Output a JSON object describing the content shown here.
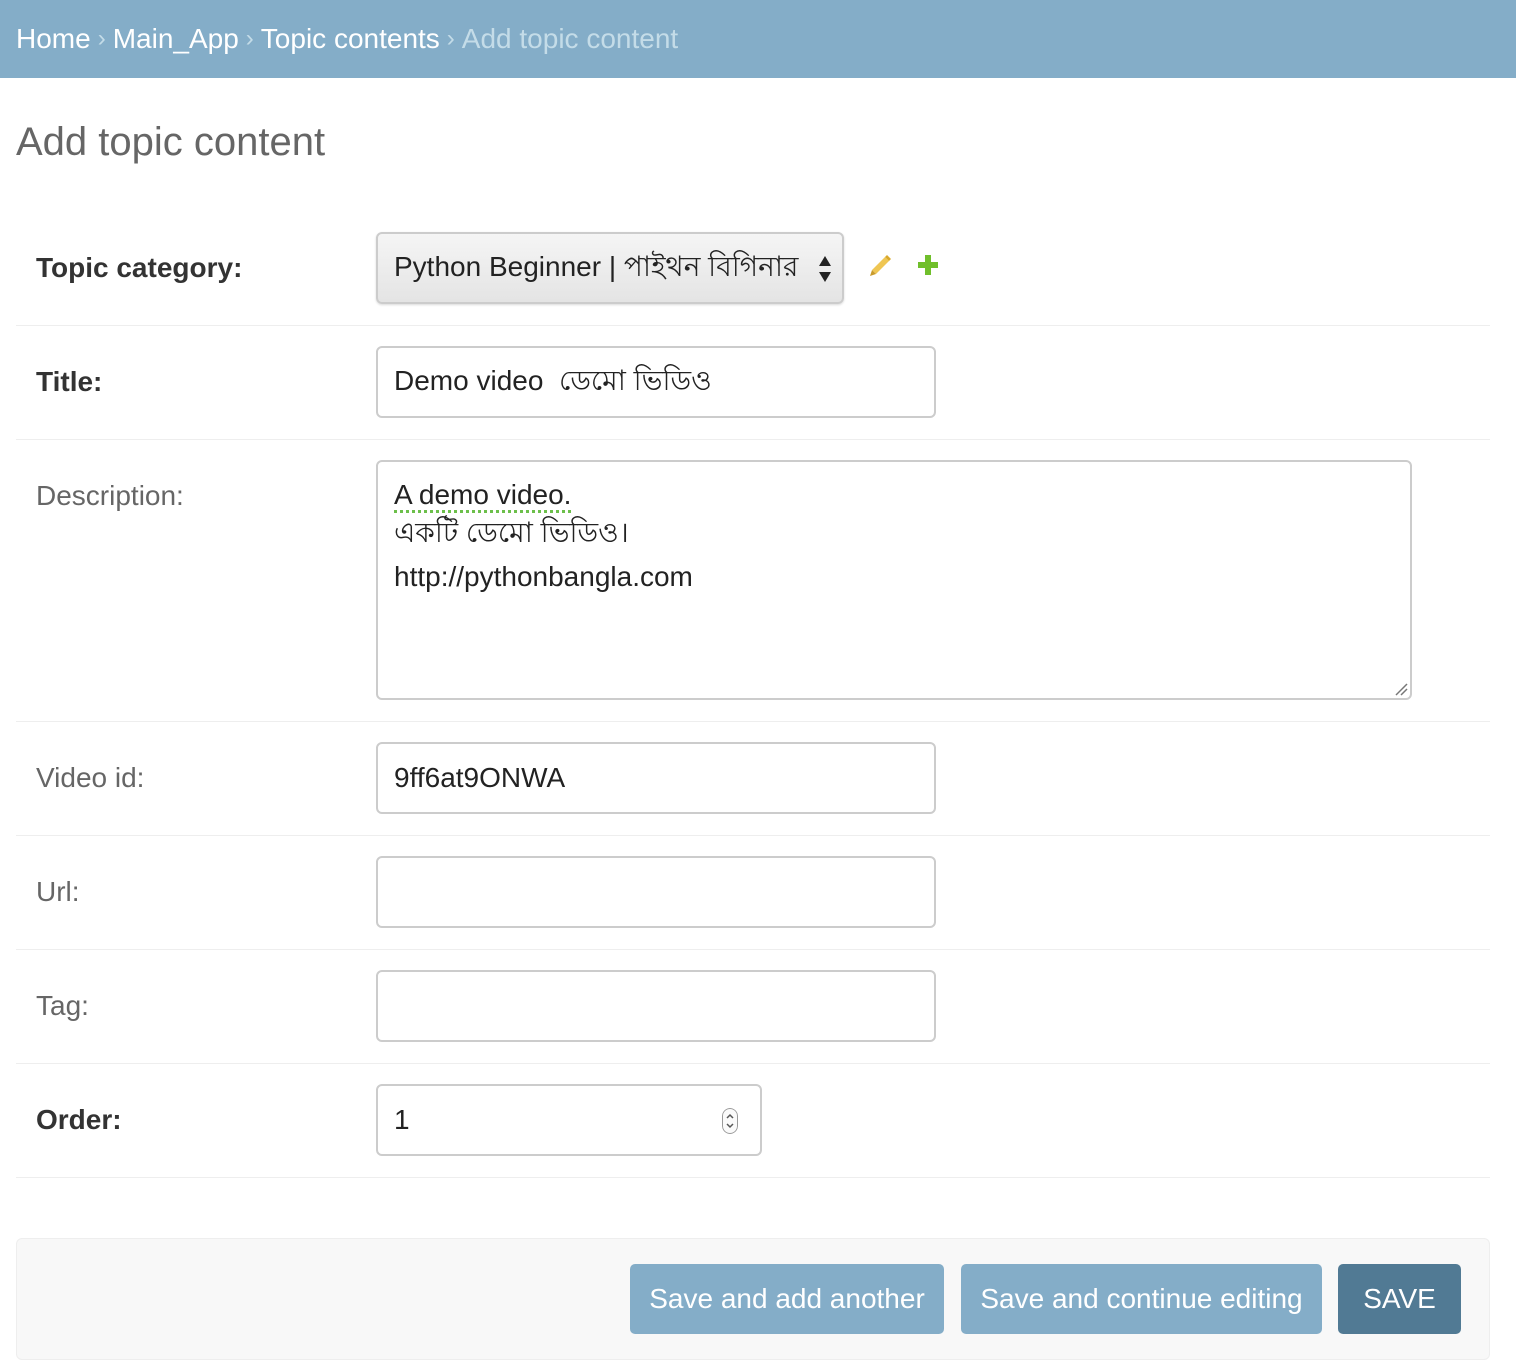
{
  "breadcrumbs": {
    "home": "Home",
    "app": "Main_App",
    "model": "Topic contents",
    "current": "Add topic content",
    "separator": "›"
  },
  "page": {
    "title": "Add topic content"
  },
  "form": {
    "topic_category": {
      "label": "Topic category:",
      "selected": "Python Beginner | পাইথন বিগিনার"
    },
    "title": {
      "label": "Title:",
      "value": "Demo video  ডেমো ভিডিও"
    },
    "description": {
      "label": "Description:",
      "line1": "A demo video.",
      "line2": "একটি ডেমো ভিডিও।",
      "line3": "http://pythonbangla.com"
    },
    "video_id": {
      "label": "Video id:",
      "value": "9ff6at9ONWA"
    },
    "url": {
      "label": "Url:",
      "value": ""
    },
    "tag": {
      "label": "Tag:",
      "value": ""
    },
    "order": {
      "label": "Order:",
      "value": "1"
    }
  },
  "buttons": {
    "save_add_another": "Save and add another",
    "save_continue": "Save and continue editing",
    "save": "SAVE"
  },
  "icons": {
    "edit": "pencil-icon",
    "add": "plus-icon"
  },
  "colors": {
    "header": "#84adc8",
    "primary_button": "#517a94",
    "secondary_button": "#84adc8",
    "edit_icon": "#efc653",
    "add_icon": "#70bf2b"
  }
}
